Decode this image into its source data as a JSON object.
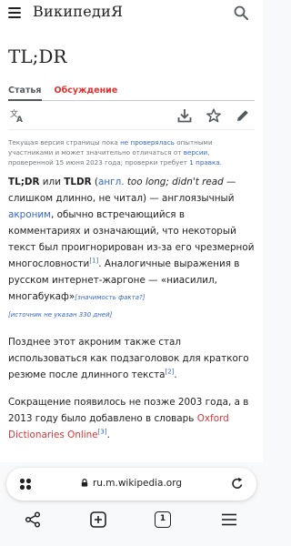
{
  "header": {
    "wordmark": "ВикипедиЯ",
    "menu_icon": "menu-icon",
    "search_icon": "search-icon"
  },
  "article": {
    "title": "TL;DR",
    "tabs": [
      {
        "label": "Статья"
      },
      {
        "label": "Обсуждение"
      }
    ]
  },
  "notice": {
    "part1": "Текущая версия страницы пока ",
    "link1": "не проверялась",
    "part2": " опытными участниками и может значительно отличаться от ",
    "link2": "версии",
    "part3": ", проверенной 15 июня 2023 года; проверки требует ",
    "link3": "1 правка",
    "part4": "."
  },
  "p1": {
    "b1": "TL;DR",
    "t1": " или ",
    "b2": "TLDR",
    "t2": " (",
    "lang": "англ.",
    "t3": " ",
    "i1": "too long; didn't read",
    "t4": " — слишком длинно, не читал) — англоязычный ",
    "acronym": "акроним",
    "t5": ", обычно встречающийся в комментариях и означающий, что некоторый текст был проигнорирован из-за его чрезмерной многословности",
    "ref1": "[1]",
    "t6": ". Аналогичные выражения в русском интернет-жаргоне — «ниасилил, многабукаф»",
    "note1": "[значимость факта?]",
    "note2": "[источник не указан 330 дней]"
  },
  "p2": {
    "text": "Позднее этот акроним также стал использоваться как подзаголовок для краткого резюме после длинного текста",
    "ref": "[2]",
    "end": "."
  },
  "p3": {
    "text": "Сокращение появилось не позже 2003 года, а в 2013 году было добавлено в словарь ",
    "link": "Oxford Dictionaries Online",
    "ref": "[3]",
    "end": "."
  },
  "browser": {
    "url": "ru.m.wikipedia.org",
    "tab_count": "1"
  }
}
